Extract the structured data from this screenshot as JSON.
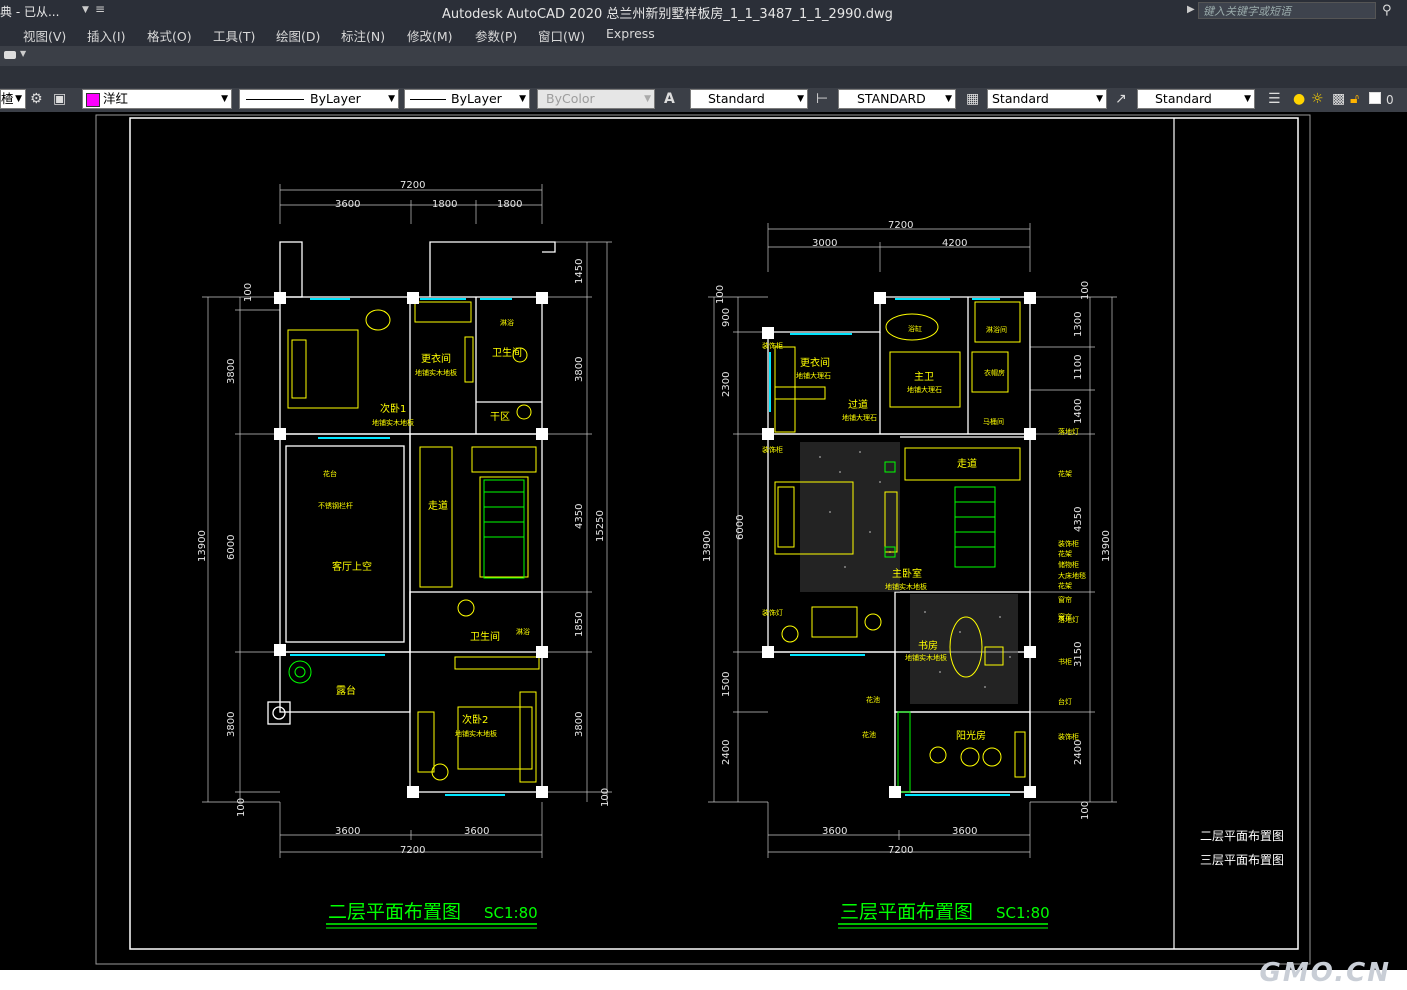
{
  "titlebar": {
    "workspace": "典 - 已从...",
    "title": "Autodesk AutoCAD 2020    总兰州新别墅样板房_1_1_3487_1_1_2990.dwg",
    "search_placeholder": "键入关键字或短语"
  },
  "menu": [
    "视图(V)",
    "插入(I)",
    "格式(O)",
    "工具(T)",
    "绘图(D)",
    "标注(N)",
    "修改(M)",
    "参数(P)",
    "窗口(W)",
    "Express"
  ],
  "toolbar": {
    "layer_left_fragment": "楂",
    "color": "洋红",
    "color_hex": "#ff00ff",
    "linetype": "ByLayer",
    "lineweight": "ByLayer",
    "plotstyle": "ByColor",
    "text_style": "Standard",
    "dim_style": "STANDARD",
    "table_style": "Standard",
    "mleader_style": "Standard",
    "layer_current": "0"
  },
  "drawing": {
    "plan2": {
      "title": "二层平面布置图",
      "scale": "SC1:80",
      "top_dims": [
        "7200",
        "3600",
        "1800",
        "1800"
      ],
      "bottom_dims": [
        "3600",
        "3600",
        "7200"
      ],
      "left_dims": [
        "100",
        "3800",
        "13900",
        "6000",
        "3800",
        "100"
      ],
      "right_dims": [
        "1450",
        "3800",
        "4350",
        "15250",
        "1850",
        "3800",
        "100"
      ],
      "rooms": [
        "更衣间",
        "地铺实木地板",
        "卫生间",
        "次卧1",
        "地铺实木地板",
        "干区",
        "走道",
        "客厅上空",
        "卫生间",
        "露台",
        "次卧2",
        "地铺实木地板"
      ],
      "annotations": [
        "花台",
        "不锈钢栏杆",
        "淋浴",
        "淋浴"
      ]
    },
    "plan3": {
      "title": "三层平面布置图",
      "scale": "SC1:80",
      "top_dims": [
        "7200",
        "3000",
        "4200"
      ],
      "bottom_dims": [
        "3600",
        "3600",
        "7200"
      ],
      "left_dims": [
        "100",
        "900",
        "2300",
        "13900",
        "6000",
        "1500",
        "2400"
      ],
      "right_dims": [
        "100",
        "1300",
        "1100",
        "1400",
        "4350",
        "13900",
        "3150",
        "2400",
        "100"
      ],
      "rooms": [
        "更衣间",
        "地铺大理石",
        "过道",
        "地铺大理石",
        "主卫",
        "地铺大理石",
        "浴缸",
        "淋浴间",
        "衣帽房",
        "马桶间",
        "走道",
        "主卧室",
        "地铺实木地板",
        "书房",
        "地铺实木地板",
        "阳光房"
      ],
      "annotations": [
        "装饰柜",
        "装饰柜",
        "花架",
        "花架",
        "装饰柜",
        "落地灯",
        "花架",
        "落地灯",
        "书柜",
        "台灯",
        "装饰灯",
        "花池",
        "花池",
        "装饰柜",
        "储物柜",
        "窗帘",
        "窗帘",
        "大床地毯"
      ]
    },
    "legend": [
      "二层平面布置图",
      "三层平面布置图"
    ]
  },
  "watermark": "GMO.CN"
}
